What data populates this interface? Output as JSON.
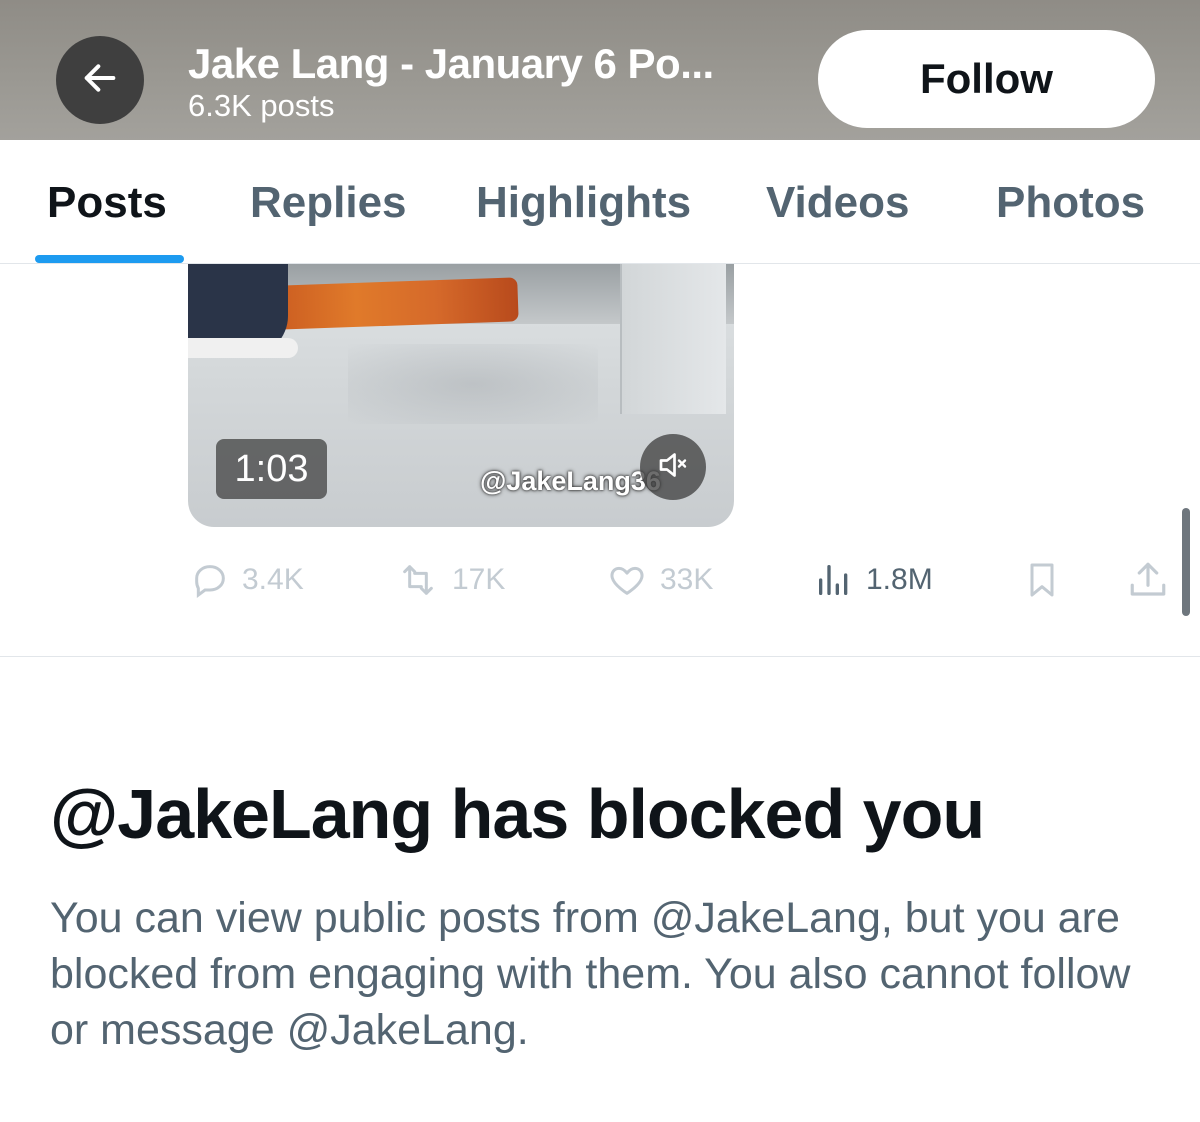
{
  "header": {
    "title": "Jake Lang - January 6 Po...",
    "post_count": "6.3K posts",
    "follow_label": "Follow",
    "back_icon": "arrow-left-icon"
  },
  "tabs": [
    {
      "label": "Posts",
      "active": true
    },
    {
      "label": "Replies",
      "active": false
    },
    {
      "label": "Highlights",
      "active": false
    },
    {
      "label": "Videos",
      "active": false
    },
    {
      "label": "Photos",
      "active": false
    }
  ],
  "video": {
    "duration": "1:03",
    "watermark": "@JakeLang36",
    "mute_icon": "speaker-muted-icon"
  },
  "actions": {
    "replies": "3.4K",
    "reposts": "17K",
    "likes": "33K",
    "views": "1.8M"
  },
  "blocked": {
    "heading": "@JakeLang has blocked you",
    "body": "You can view public posts from @JakeLang, but you are blocked from engaging with them. You also cannot follow or message @JakeLang."
  },
  "colors": {
    "accent": "#1d9bf0",
    "text_primary": "#0f1419",
    "text_secondary": "#536471",
    "disabled": "#c3cbd2"
  }
}
